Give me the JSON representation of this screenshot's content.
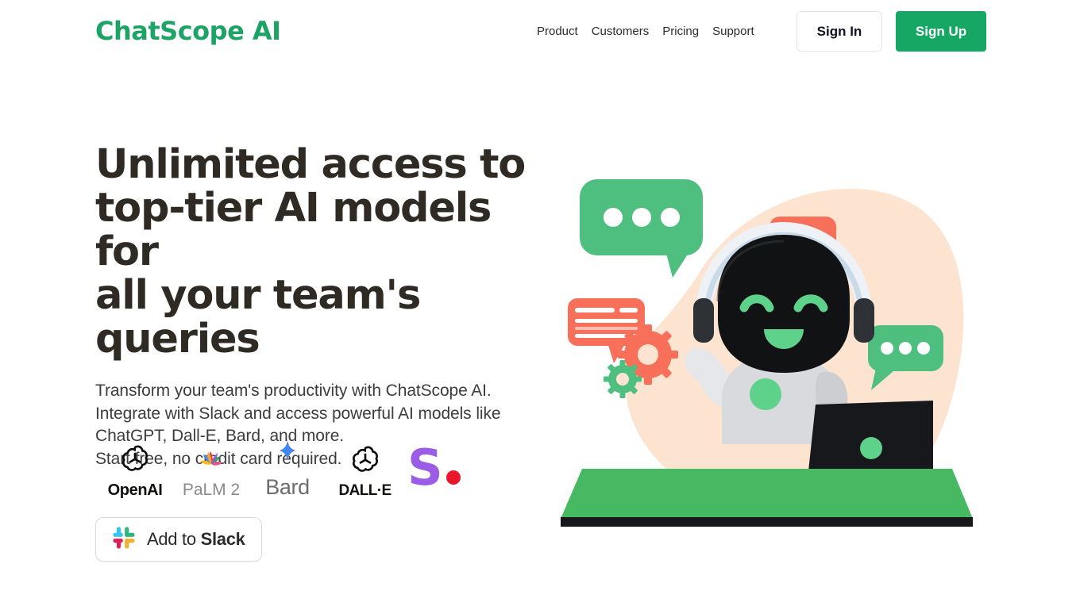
{
  "brand": {
    "logo_text": "ChatScope AI",
    "logo_color": "#1da365"
  },
  "header": {
    "nav": [
      {
        "label": "Product"
      },
      {
        "label": "Customers"
      },
      {
        "label": "Pricing"
      },
      {
        "label": "Support"
      }
    ],
    "sign_in_label": "Sign In",
    "sign_up_label": "Sign Up"
  },
  "hero": {
    "title_line1": "Unlimited access to",
    "title_line2": "top-tier AI models for",
    "title_line3": "all your team's queries",
    "sub_line1": "Transform your team's productivity with ChatScope AI.",
    "sub_line2": "Integrate with Slack and access powerful AI models like",
    "sub_line3": "ChatGPT, Dall-E, Bard, and more.",
    "sub_line4": "Start free, no credit card required.",
    "cta": {
      "prefix": "Add to ",
      "brand": "Slack",
      "icon": "slack-icon"
    }
  },
  "partners": [
    {
      "name": "OpenAI",
      "label": "OpenAI",
      "icon": "openai-knot-icon"
    },
    {
      "name": "PaLM 2",
      "label": "PaLM 2",
      "icon": "palm-pinwheel-icon"
    },
    {
      "name": "Bard",
      "label": "Bard",
      "icon": "bard-sparkle-icon"
    },
    {
      "name": "DALL-E",
      "label": "DALL·E",
      "icon": "openai-knot-icon"
    },
    {
      "name": "Stability AI",
      "label": "",
      "icon": "stability-s-icon"
    }
  ],
  "illustration": {
    "name": "robot-chat-hero-illustration",
    "colors": {
      "blob": "#fde4d0",
      "bubble_green": "#4fbf7f",
      "bubble_orange": "#f8705a",
      "desk_green": "#47b963",
      "desk_edge": "#17181c",
      "robot_body": "#d9dadd",
      "robot_head": "#111214",
      "robot_eye": "#5ed18a",
      "laptop": "#17181c"
    },
    "elements": [
      "peach-blob",
      "green-speech-bubble-top-left",
      "orange-speech-bubble-top-right",
      "orange-text-bubble-left",
      "green-speech-bubble-right",
      "robot-with-headphones",
      "laptop",
      "green-desk",
      "gears"
    ]
  },
  "theme": {
    "accent_green": "#16a765",
    "heading_color": "#2f2a24",
    "body_text_color": "#3d3d3d",
    "background": "#ffffff"
  }
}
